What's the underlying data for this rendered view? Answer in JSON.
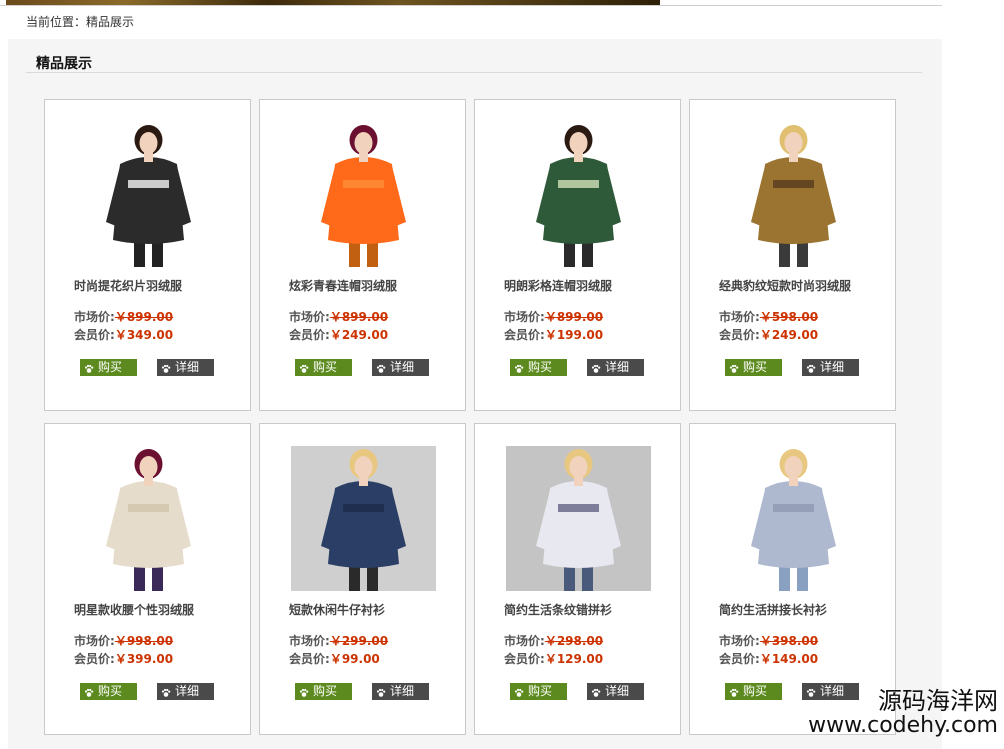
{
  "breadcrumb": {
    "text": "当前位置：精品展示"
  },
  "section": {
    "title": "精品展示"
  },
  "labels": {
    "market": "市场价:",
    "member": "会员价:",
    "buy": "购买",
    "detail": "详细"
  },
  "products": [
    {
      "name": "时尚提花织片羽绒服",
      "market_price": "￥899.00",
      "member_price": "￥349.00",
      "bg": "#ffffff",
      "top": "#2b2b2b",
      "accent": "#e8e8e8",
      "hair": "#2a1a12",
      "bottom": "#222222"
    },
    {
      "name": "炫彩青春连帽羽绒服",
      "market_price": "￥899.00",
      "member_price": "￥249.00",
      "bg": "#ffffff",
      "top": "#ff6a1a",
      "accent": "#ff8c3a",
      "hair": "#6b1030",
      "bottom": "#c06010"
    },
    {
      "name": "明朗彩格连帽羽绒服",
      "market_price": "￥899.00",
      "member_price": "￥199.00",
      "bg": "#ffffff",
      "top": "#2f5a3a",
      "accent": "#c8d8b0",
      "hair": "#2a1a12",
      "bottom": "#2a2a2a"
    },
    {
      "name": "经典豹纹短款时尚羽绒服",
      "market_price": "￥598.00",
      "member_price": "￥249.00",
      "bg": "#ffffff",
      "top": "#9a7430",
      "accent": "#5a4020",
      "hair": "#e0c070",
      "bottom": "#3a3a3a"
    },
    {
      "name": "明星款收腰个性羽绒服",
      "market_price": "￥998.00",
      "member_price": "￥399.00",
      "bg": "#ffffff",
      "top": "#e6dccb",
      "accent": "#d2c6ad",
      "hair": "#6b1030",
      "bottom": "#3a2a5a"
    },
    {
      "name": "短款休闲牛仔衬衫",
      "market_price": "￥299.00",
      "member_price": "￥99.00",
      "bg": "#cfcfcf",
      "top": "#2b3e66",
      "accent": "#1d2b4a",
      "hair": "#e8c880",
      "bottom": "#2a2a2a"
    },
    {
      "name": "简约生活条纹错拼衫",
      "market_price": "￥298.00",
      "member_price": "￥129.00",
      "bg": "#c4c4c4",
      "top": "#e8e8f0",
      "accent": "#6a6a8a",
      "hair": "#e8c880",
      "bottom": "#4a5a7a"
    },
    {
      "name": "简约生活拼接长衬衫",
      "market_price": "￥398.00",
      "member_price": "￥149.00",
      "bg": "#ffffff",
      "top": "#aeb8cf",
      "accent": "#909ab4",
      "hair": "#e8c880",
      "bottom": "#8aa0c0"
    }
  ],
  "watermark": {
    "line1": "源码海洋网",
    "line2": "www.codehy.com"
  }
}
